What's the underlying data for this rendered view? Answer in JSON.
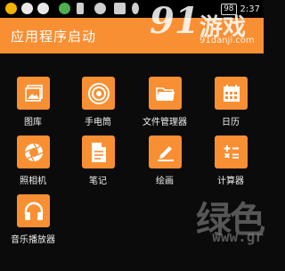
{
  "status_bar": {
    "battery": "98",
    "time": "2:37"
  },
  "app_bar": {
    "title": "应用程序启动"
  },
  "watermark": {
    "brand_number": "91",
    "brand_name": "游戏",
    "url": "91danji.com",
    "bottom_text": "绿色",
    "bottom_url": "www.gr"
  },
  "apps": [
    {
      "label": "图库",
      "icon": "gallery-icon"
    },
    {
      "label": "手电筒",
      "icon": "flashlight-icon"
    },
    {
      "label": "文件管理器",
      "icon": "folder-icon"
    },
    {
      "label": "日历",
      "icon": "calendar-icon"
    },
    {
      "label": "照相机",
      "icon": "camera-icon"
    },
    {
      "label": "笔记",
      "icon": "notes-icon"
    },
    {
      "label": "绘画",
      "icon": "paint-icon"
    },
    {
      "label": "计算器",
      "icon": "calculator-icon"
    },
    {
      "label": "音乐播放器",
      "icon": "headphones-icon"
    }
  ],
  "colors": {
    "accent": "#f98f33",
    "background": "#0b0b0b"
  }
}
